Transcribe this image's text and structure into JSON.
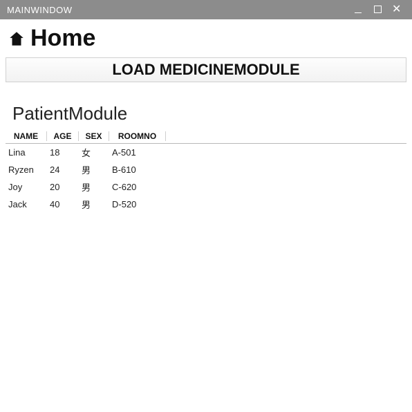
{
  "window": {
    "title": "MAINWINDOW"
  },
  "header": {
    "home_label": "Home"
  },
  "load_button": {
    "label": "LOAD MEDICINEMODULE"
  },
  "module": {
    "title": "PatientModule"
  },
  "grid": {
    "columns": {
      "name": "NAME",
      "age": "AGE",
      "sex": "SEX",
      "room": "ROOMNO"
    },
    "rows": [
      {
        "name": "Lina",
        "age": "18",
        "sex": "女",
        "room": "A-501"
      },
      {
        "name": "Ryzen",
        "age": "24",
        "sex": "男",
        "room": "B-610"
      },
      {
        "name": "Joy",
        "age": "20",
        "sex": "男",
        "room": "C-620"
      },
      {
        "name": "Jack",
        "age": "40",
        "sex": "男",
        "room": "D-520"
      }
    ]
  }
}
